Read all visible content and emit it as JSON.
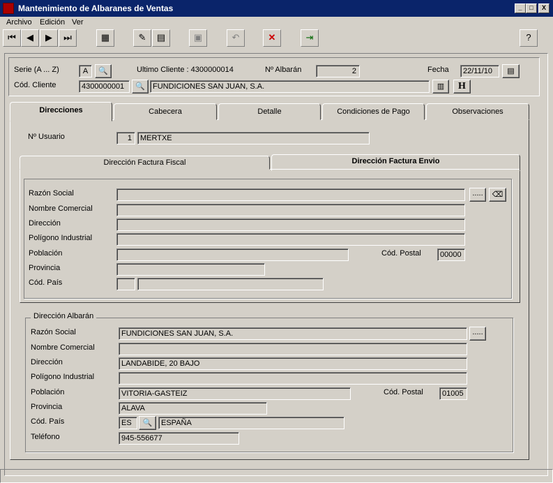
{
  "window": {
    "title": "Mantenimiento de Albaranes de Ventas",
    "min_label": "_",
    "max_label": "□",
    "close_label": "X"
  },
  "menu": [
    "Archivo",
    "Edición",
    "Ver"
  ],
  "toolbar": {
    "icons": [
      "first-record-icon",
      "prev-record-icon",
      "next-record-icon",
      "last-record-icon",
      "calculator-icon",
      "new-icon",
      "edit-icon",
      "save-icon",
      "undo-icon",
      "delete-icon",
      "exit-icon",
      "help-icon"
    ]
  },
  "header": {
    "serie_label": "Serie (A ... Z)",
    "serie_value": "A",
    "ultimo_cliente": "Ultimo Cliente : 4300000014",
    "albaran_label": "Nº Albarán",
    "albaran_value": "2",
    "fecha_label": "Fecha",
    "fecha_value": "22/11/10",
    "cliente_label": "Cód. Cliente",
    "cliente_code": "4300000001",
    "cliente_name": "FUNDICIONES SAN JUAN, S.A.",
    "h_button": "H"
  },
  "tabs": [
    "Direcciones",
    "Cabecera",
    "Detalle",
    "Condiciones de Pago",
    "Observaciones"
  ],
  "usuario": {
    "label": "Nº Usuario",
    "num": "1",
    "name": "MERTXE"
  },
  "subtabs": [
    "Dirección Factura Fiscal",
    "Dirección Factura Envio"
  ],
  "envio": {
    "razon_label": "Razón Social",
    "nombre_label": "Nombre Comercial",
    "direccion_label": "Dirección",
    "poligono_label": "Polígono Industrial",
    "poblacion_label": "Población",
    "cp_label": "Cód. Postal",
    "cp_value": "00000",
    "provincia_label": "Provincia",
    "pais_label": "Cód. País",
    "dots": "....."
  },
  "albaran": {
    "group_title": "Dirección Albarán",
    "razon_label": "Razón Social",
    "razon_value": "FUNDICIONES SAN JUAN, S.A.",
    "nombre_label": "Nombre Comercial",
    "direccion_label": "Dirección",
    "direccion_value": "LANDABIDE, 20 BAJO",
    "poligono_label": "Polígono Industrial",
    "poblacion_label": "Población",
    "poblacion_value": "VITORIA-GASTEIZ",
    "cp_label": "Cód. Postal",
    "cp_value": "01005",
    "provincia_label": "Provincia",
    "provincia_value": "ALAVA",
    "pais_label": "Cód. País",
    "pais_code": "ES",
    "pais_name": "ESPAÑA",
    "telefono_label": "Teléfono",
    "telefono_value": "945-556677",
    "dots": "....."
  }
}
